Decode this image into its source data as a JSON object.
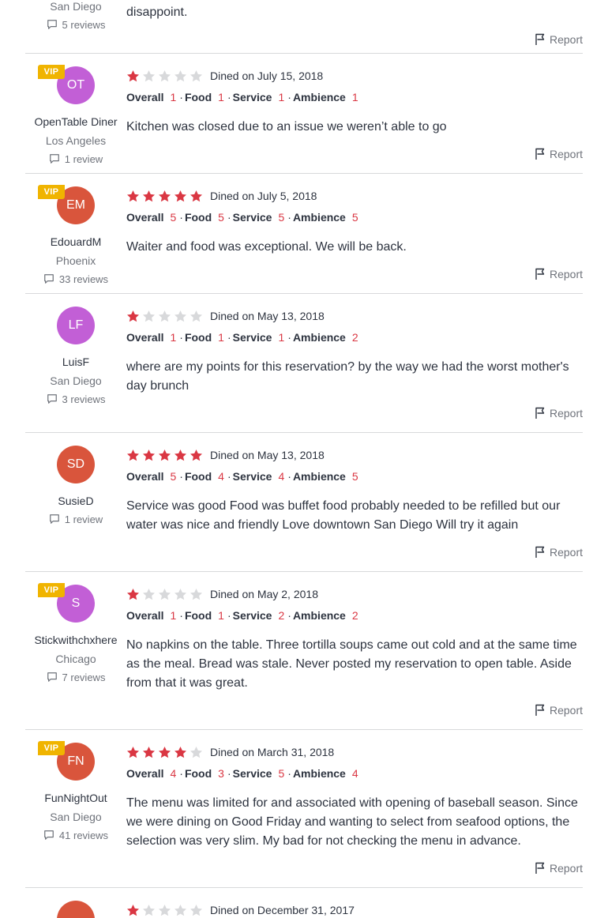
{
  "star_color": "#da3743",
  "vip_label": "VIP",
  "report_label": "Report",
  "first_review": {
    "location": "San Diego",
    "reviews": "5 reviews",
    "text": "disappoint."
  },
  "reviews": [
    {
      "vip": true,
      "initials": "OT",
      "avatar_color": "purple",
      "name": "OpenTable Diner",
      "location": "Los Angeles",
      "review_count": "1 review",
      "stars": 1,
      "dined": "Dined on July 15, 2018",
      "overall": "1",
      "food": "1",
      "service": "1",
      "ambience": "1",
      "text": "Kitchen was closed due to an issue we weren’t able to go"
    },
    {
      "vip": true,
      "initials": "EM",
      "avatar_color": "orange",
      "name": "EdouardM",
      "location": "Phoenix",
      "review_count": "33 reviews",
      "stars": 5,
      "dined": "Dined on July 5, 2018",
      "overall": "5",
      "food": "5",
      "service": "5",
      "ambience": "5",
      "text": "Waiter and food was exceptional. We will be back."
    },
    {
      "vip": false,
      "initials": "LF",
      "avatar_color": "purple",
      "name": "LuisF",
      "location": "San Diego",
      "review_count": "3 reviews",
      "stars": 1,
      "dined": "Dined on May 13, 2018",
      "overall": "1",
      "food": "1",
      "service": "1",
      "ambience": "2",
      "text": "where are my points for this reservation? by the way we had the worst mother's day brunch"
    },
    {
      "vip": false,
      "initials": "SD",
      "avatar_color": "orange",
      "name": "SusieD",
      "location": "",
      "review_count": "1 review",
      "stars": 5,
      "dined": "Dined on May 13, 2018",
      "overall": "5",
      "food": "4",
      "service": "4",
      "ambience": "5",
      "text": "Service was good Food was buffet food probably needed to be refilled but our water was nice and friendly Love downtown San Diego Will try it again"
    },
    {
      "vip": true,
      "initials": "S",
      "avatar_color": "purple",
      "name": "Stickwithchxhere",
      "location": "Chicago",
      "review_count": "7 reviews",
      "stars": 1,
      "dined": "Dined on May 2, 2018",
      "overall": "1",
      "food": "1",
      "service": "2",
      "ambience": "2",
      "text": "No napkins on the table. Three tortilla soups came out cold and at the same time as the meal. Bread was stale. Never posted my reservation to open table. Aside from that it was great."
    },
    {
      "vip": true,
      "initials": "FN",
      "avatar_color": "orange",
      "name": "FunNightOut",
      "location": "San Diego",
      "review_count": "41 reviews",
      "stars": 4,
      "dined": "Dined on March 31, 2018",
      "overall": "4",
      "food": "3",
      "service": "5",
      "ambience": "4",
      "text": "The menu was limited for and associated with opening of baseball season. Since we were dining on Good Friday and wanting to select from seafood options, the selection was very slim. My bad for not checking the menu in advance."
    },
    {
      "vip": false,
      "initials": "",
      "avatar_color": "orange",
      "name": "",
      "location": "",
      "review_count": "",
      "stars": 1,
      "dined": "Dined on December 31, 2017",
      "overall": "",
      "food": "",
      "service": "",
      "ambience": "",
      "text": ""
    }
  ],
  "labels": {
    "overall": "Overall",
    "food": "Food",
    "service": "Service",
    "ambience": "Ambience"
  }
}
